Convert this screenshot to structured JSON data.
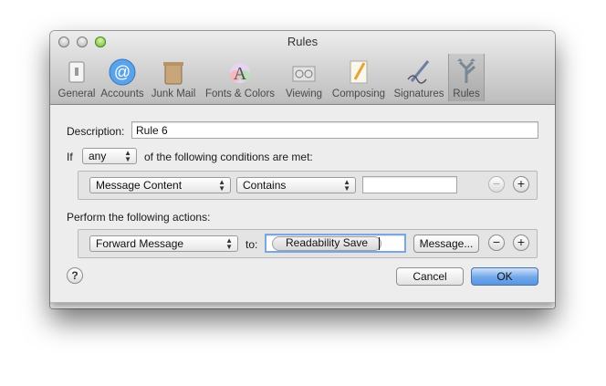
{
  "window": {
    "title": "Rules",
    "toolbar": [
      {
        "label": "General",
        "icon": "light-switch-icon"
      },
      {
        "label": "Accounts",
        "icon": "at-sign-icon"
      },
      {
        "label": "Junk Mail",
        "icon": "trash-can-icon"
      },
      {
        "label": "Fonts & Colors",
        "icon": "color-a-icon"
      },
      {
        "label": "Viewing",
        "icon": "glasses-icon"
      },
      {
        "label": "Composing",
        "icon": "pencil-paper-icon"
      },
      {
        "label": "Signatures",
        "icon": "pen-signature-icon"
      },
      {
        "label": "Rules",
        "icon": "rules-arrows-icon"
      }
    ],
    "active_tab": "Rules"
  },
  "sheet": {
    "description_label": "Description:",
    "description_value": "Rule 6",
    "if_label": "If",
    "match_selected": "any",
    "conditions_suffix": "of the following conditions are met:",
    "condition": {
      "field": "Message Content",
      "operator": "Contains",
      "value": ""
    },
    "actions_label": "Perform the following actions:",
    "action": {
      "type": "Forward Message",
      "to_label": "to:",
      "recipient": "Readability Save",
      "message_button": "Message..."
    },
    "minus": "−",
    "plus": "+",
    "help": "?",
    "cancel": "Cancel",
    "ok": "OK"
  }
}
